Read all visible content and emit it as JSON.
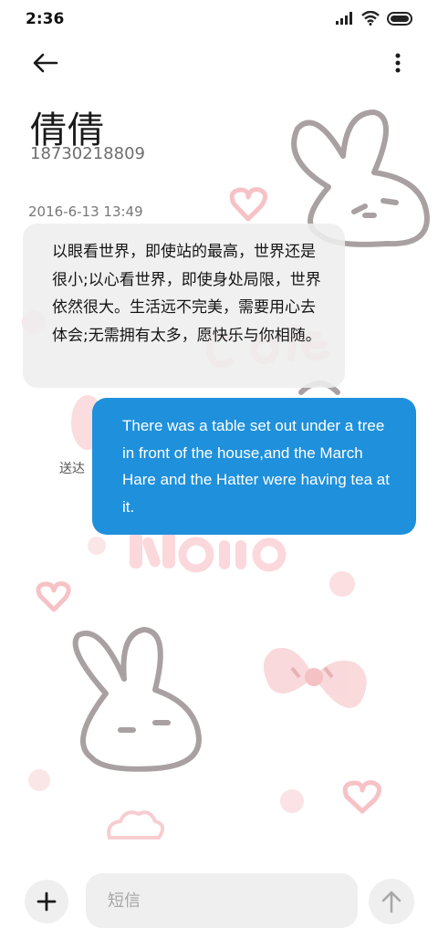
{
  "status_bar": {
    "time": "2:36",
    "icons": [
      "signal-icon",
      "wifi-icon",
      "battery-icon"
    ]
  },
  "toolbar": {
    "back_icon": "arrow-left-icon",
    "more_icon": "more-vertical-icon"
  },
  "contact": {
    "name": "倩倩",
    "number": "18730218809"
  },
  "conversation": {
    "timestamp": "2016-6-13 13:49",
    "incoming": {
      "text": "以眼看世界，即使站的最高，世界还是很小;以心看世界，即使身处局限，世界依然很大。生活远不完美，需要用心去体会;无需拥有太多，愿快乐与你相随。"
    },
    "outgoing": {
      "text": "There was a table set out under a tree in front of the house,and the March Hare and the Hatter were having tea at it.",
      "status": "送达"
    }
  },
  "composer": {
    "add_icon": "plus-icon",
    "placeholder": "短信",
    "send_icon": "arrow-up-icon"
  },
  "colors": {
    "outgoing_bubble": "#1f90db",
    "incoming_bubble": "#eeeeee",
    "wallpaper_pink": "#f7c9cc",
    "wallpaper_gray": "#a9a1a1"
  }
}
